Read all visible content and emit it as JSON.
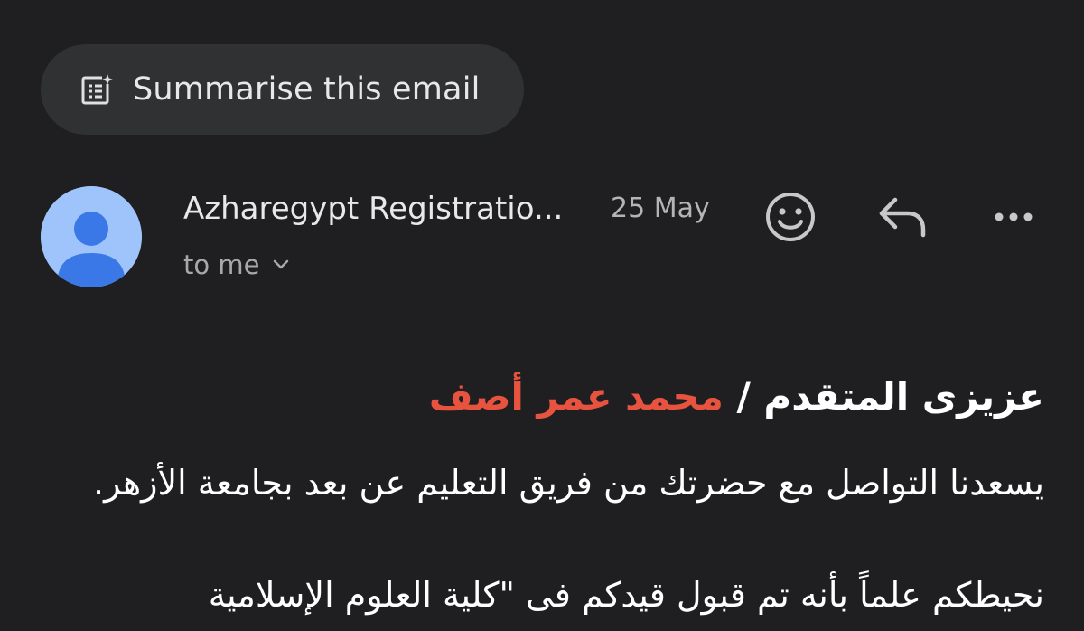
{
  "summarise": {
    "label": "Summarise this email",
    "icon": "summary-sparkle-icon"
  },
  "message": {
    "sender": "Azharegypt Registratio...",
    "date": "25 May",
    "recipient": "to me",
    "avatar_color": "#9fc4fb",
    "avatar_figure_color": "#3b78e7"
  },
  "actions": {
    "emoji": "add-reaction-icon",
    "reply": "reply-icon",
    "more": "more-options-icon"
  },
  "body": {
    "greeting_prefix": "عزيزى المتقدم / ",
    "greeting_name": "محمد عمر أصف",
    "name_color": "#e8533f",
    "paragraph1": "يسعدنا التواصل مع حضرتك من فريق التعليم عن بعد بجامعة الأزهر.",
    "paragraph2": "نحيطكم علماً بأنه تم قبول قيدكم فى \"كلية العلوم الإسلامية"
  }
}
